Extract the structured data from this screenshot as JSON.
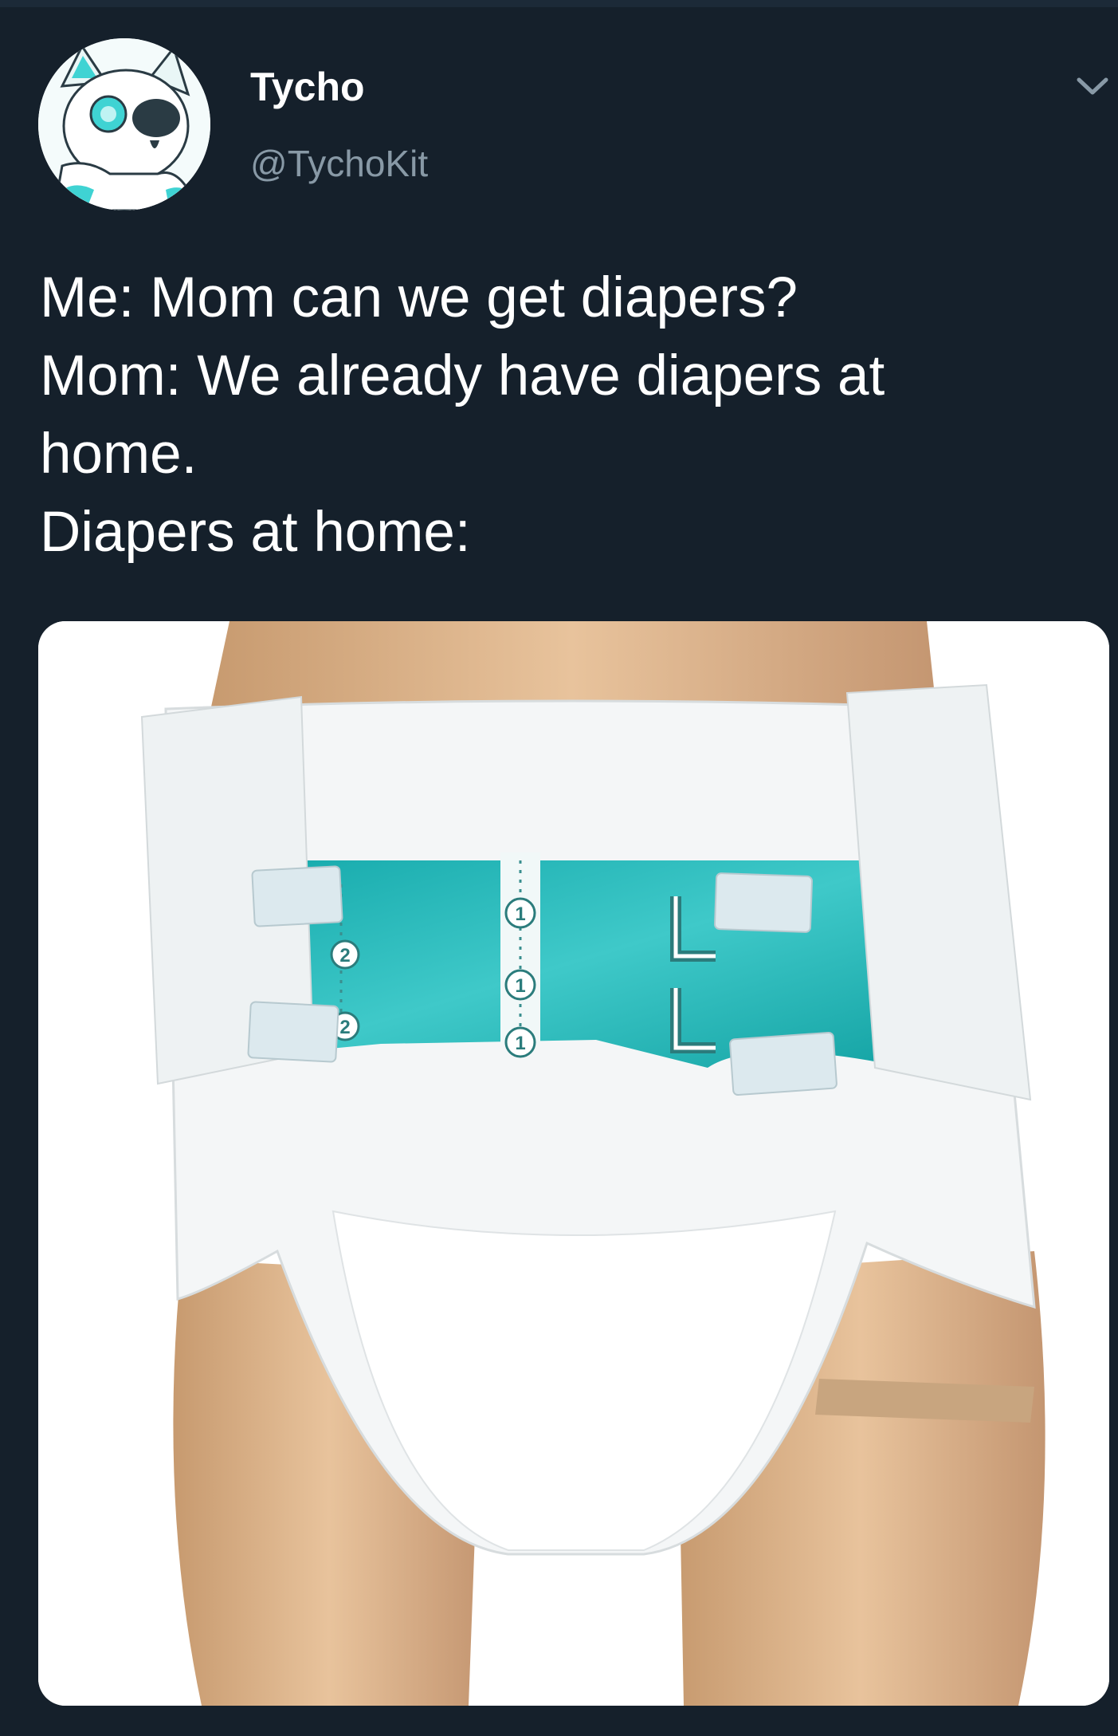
{
  "tweet": {
    "author": {
      "display_name": "Tycho",
      "handle": "@TychoKit",
      "avatar_icon": "avatar-white-fox-character-icon"
    },
    "menu_icon": "chevron-down-icon",
    "text_lines": [
      "Me: Mom can we get diapers?",
      "Mom: We already have diapers at",
      "home.",
      "Diapers at home:"
    ],
    "media": {
      "icon": "photo-adult-diaper-on-mannequin",
      "numbers": [
        "1",
        "1",
        "1",
        "2",
        "2"
      ],
      "size_letters": [
        "L",
        "L"
      ]
    }
  },
  "colors": {
    "background": "#15202b",
    "text": "#ffffff",
    "secondary_text": "#8899a6",
    "accent_teal": "#1fb3b5"
  }
}
